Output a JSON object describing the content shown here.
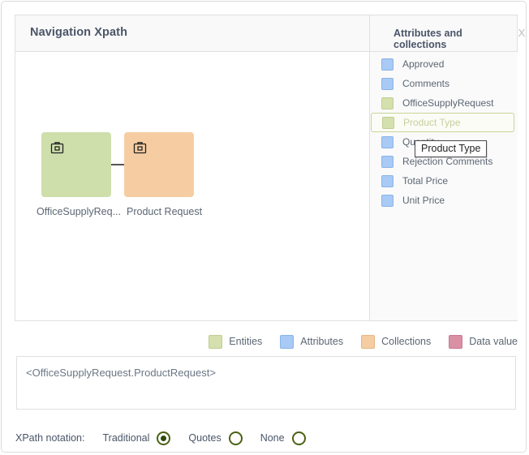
{
  "panel": {
    "nav_title": "Navigation Xpath",
    "attributes_title": "Attributes and collections",
    "close_label": "X"
  },
  "diagram": {
    "nodes": [
      {
        "label": "OfficeSupplyReq...",
        "type": "entity",
        "color": "#cedfac",
        "icon": "briefcase-icon"
      },
      {
        "label": "Product Request",
        "type": "collection",
        "color": "#f6cda2",
        "icon": "briefcase-icon"
      }
    ]
  },
  "attributes_list": {
    "items": [
      {
        "label": "Approved",
        "kind": "attribute",
        "selected": false
      },
      {
        "label": "Comments",
        "kind": "attribute",
        "selected": false
      },
      {
        "label": "OfficeSupplyRequest",
        "kind": "entity",
        "selected": false
      },
      {
        "label": "Product Type",
        "kind": "entity",
        "selected": true
      },
      {
        "label": "Quantity",
        "kind": "attribute",
        "selected": false
      },
      {
        "label": "Rejection Comments",
        "kind": "attribute",
        "selected": false
      },
      {
        "label": "Total Price",
        "kind": "attribute",
        "selected": false
      },
      {
        "label": "Unit Price",
        "kind": "attribute",
        "selected": false
      }
    ]
  },
  "tooltip": {
    "text": "Product Type"
  },
  "legend": {
    "items": [
      {
        "label": "Entities",
        "color": "#d4e0ad"
      },
      {
        "label": "Attributes",
        "color": "#a8caf5"
      },
      {
        "label": "Collections",
        "color": "#f6cda2"
      },
      {
        "label": "Data value",
        "color": "#d990a5"
      }
    ]
  },
  "xpath": {
    "expression": "<OfficeSupplyRequest.ProductRequest>"
  },
  "notation": {
    "caption": "XPath notation:",
    "options": [
      {
        "label": "Traditional",
        "selected": true
      },
      {
        "label": "Quotes",
        "selected": false
      },
      {
        "label": "None",
        "selected": false
      }
    ]
  }
}
